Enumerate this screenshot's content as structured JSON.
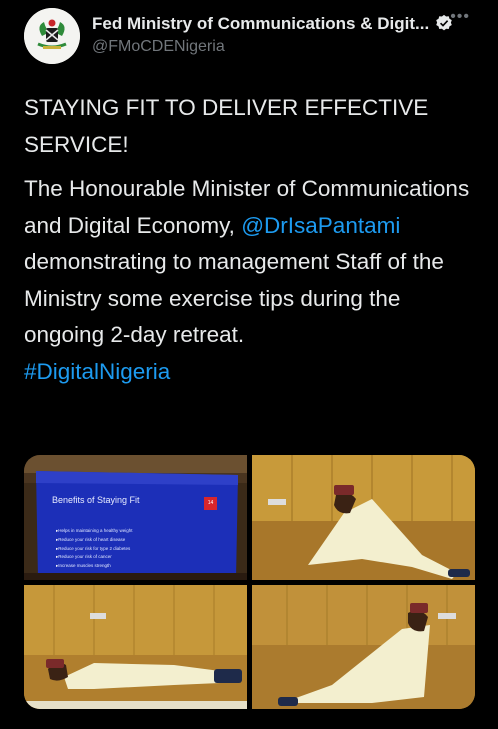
{
  "account": {
    "display_name": "Fed Ministry of Communications & Digit...",
    "handle": "@FMoCDENigeria",
    "more_icon": "more-horizontal-icon",
    "verified_icon": "verified-badge-icon"
  },
  "tweet": {
    "headline": "STAYING FIT TO DELIVER EFFECTIVE SERVICE!",
    "body_before_mention": "The Honourable Minister of Communications and Digital Economy,",
    "mention": "@DrIsaPantami",
    "body_after_mention": "demonstrating to management Staff of the Ministry some exercise tips during the ongoing 2-day retreat.",
    "hashtag": "#DigitalNigeria"
  },
  "media": {
    "slide_title": "Benefits of Staying Fit",
    "slide_page": "14",
    "slide_bullets": [
      "Helps in maintaining a healthy weight",
      "Reduce your risk of heart disease",
      "Reduce your risk for type 2 diabetes",
      "Reduce your risk of cancer",
      "Increase muscles strength"
    ]
  },
  "colors": {
    "background": "#000000",
    "text": "#e7e9ea",
    "secondary_text": "#71767b",
    "link": "#1d9bf0"
  }
}
